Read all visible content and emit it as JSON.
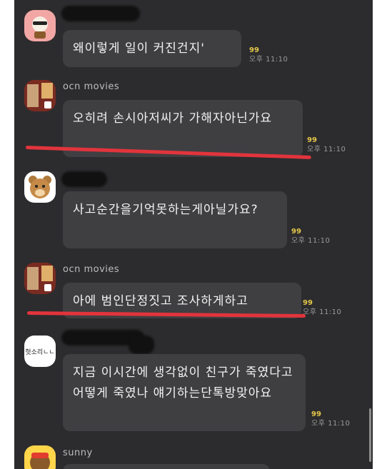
{
  "messages": [
    {
      "sender": "",
      "avatar_icon": "sunglasses-character-icon",
      "text": "왜이렇게 일이 커진건지'",
      "read_count": "99",
      "time": "오후 11:10"
    },
    {
      "sender": "ocn movies",
      "avatar_icon": "movie-poster-icon",
      "text": "오히려 손시아저씨가 가해자아닌가요",
      "read_count": "99",
      "time": "오후 11:10"
    },
    {
      "sender": "",
      "avatar_icon": "bear-icon",
      "text": "사고순간을기억못하는게아닐가요?",
      "read_count": "99",
      "time": "오후 11:10"
    },
    {
      "sender": "ocn movies",
      "avatar_icon": "movie-poster-icon",
      "text": "아에 범인단정짓고 조사하게하고",
      "read_count": "99",
      "time": "오후 11:10"
    },
    {
      "sender": "",
      "avatar_icon": "text-avatar-icon",
      "avatar_text": "헛소리ㄴㄴ",
      "text": "지금 이시간에 생각없이 친구가 죽였다고 어떻게 죽였나 얘기하는단톡방맞아요",
      "read_count": "99",
      "time": "오후 11:10"
    },
    {
      "sender": "sunny",
      "avatar_icon": "sunny-character-icon"
    }
  ],
  "colors": {
    "background": "#2c2c2e",
    "bubble": "#3f3f42",
    "highlight_underline": "#e2343c",
    "read_count": "#e4c64a"
  }
}
